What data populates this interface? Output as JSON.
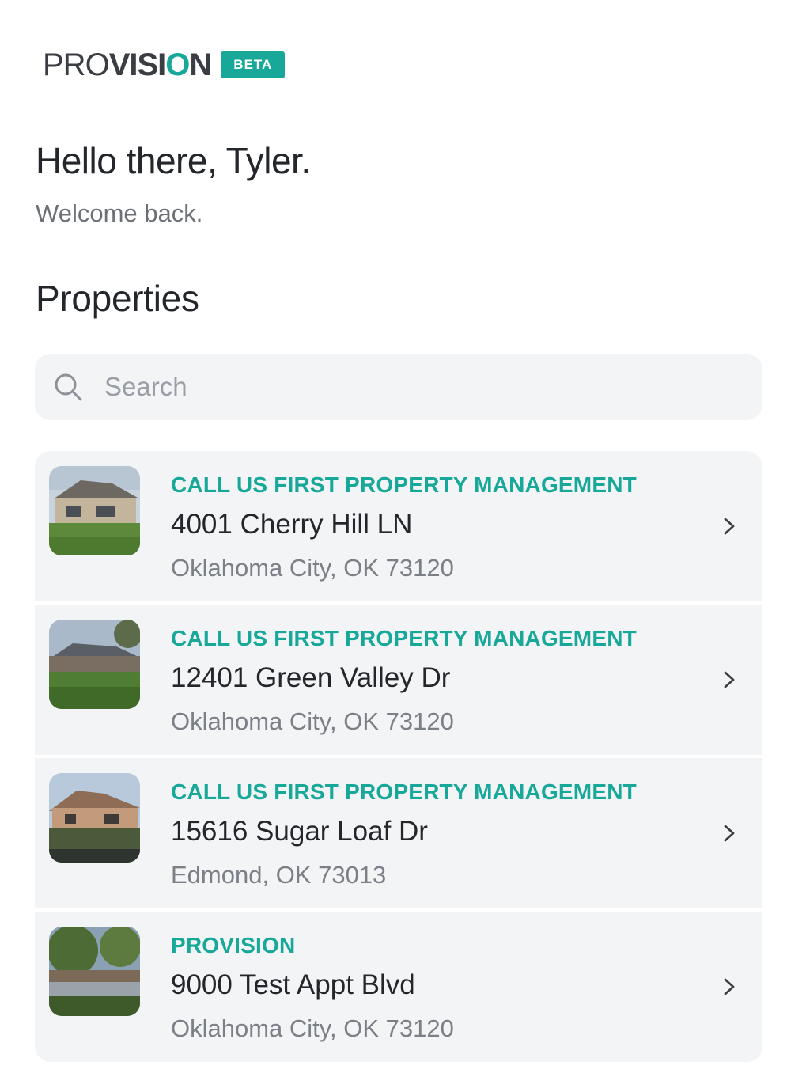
{
  "brand": {
    "logo_pro": "PRO",
    "logo_vision_pre": "VISI",
    "logo_vision_o": "O",
    "logo_vision_post": "N",
    "badge": "BETA",
    "accent_color": "#17a89a"
  },
  "greeting": {
    "title": "Hello there, Tyler.",
    "subtitle": "Welcome back."
  },
  "properties": {
    "section_title": "Properties",
    "search": {
      "placeholder": "Search",
      "value": "",
      "icon": "search-icon"
    },
    "items": [
      {
        "company": "CALL US FIRST PROPERTY MANAGEMENT",
        "street": "4001 Cherry Hill LN",
        "city": "Oklahoma City, OK 73120",
        "icon": "chevron-right-icon"
      },
      {
        "company": "CALL US FIRST PROPERTY MANAGEMENT",
        "street": "12401 Green Valley Dr",
        "city": "Oklahoma City, OK 73120",
        "icon": "chevron-right-icon"
      },
      {
        "company": "CALL US FIRST PROPERTY MANAGEMENT",
        "street": "15616 Sugar Loaf Dr",
        "city": "Edmond, OK 73013",
        "icon": "chevron-right-icon"
      },
      {
        "company": "PROVISION",
        "street": "9000 Test Appt Blvd",
        "city": "Oklahoma City, OK 73120",
        "icon": "chevron-right-icon"
      }
    ]
  }
}
